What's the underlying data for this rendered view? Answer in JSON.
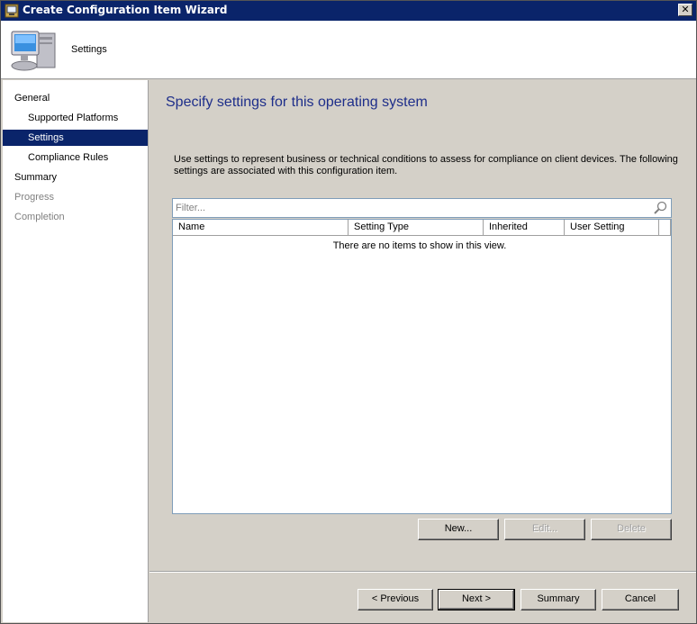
{
  "window": {
    "title": "Create Configuration Item Wizard",
    "close_glyph": "✕"
  },
  "header": {
    "title": "Settings",
    "icon": "computer-icon"
  },
  "nav": {
    "items": [
      {
        "label": "General",
        "state": "normal"
      },
      {
        "label": "Supported Platforms",
        "state": "normal"
      },
      {
        "label": "Settings",
        "state": "selected"
      },
      {
        "label": "Compliance Rules",
        "state": "normal"
      },
      {
        "label": "Summary",
        "state": "normal"
      },
      {
        "label": "Progress",
        "state": "disabled"
      },
      {
        "label": "Completion",
        "state": "disabled"
      }
    ]
  },
  "main": {
    "heading": "Specify settings for this operating system",
    "description": "Use settings to represent business or technical conditions to assess for compliance on client devices. The following settings are associated with this configuration item.",
    "filter": {
      "placeholder": "Filter...",
      "value": ""
    },
    "grid": {
      "columns": [
        "Name",
        "Setting Type",
        "Inherited",
        "User Setting"
      ],
      "empty_message": "There are no items to show in this view."
    },
    "buttons": {
      "new": "New...",
      "edit": "Edit...",
      "delete": "Delete"
    }
  },
  "footer": {
    "previous": "< Previous",
    "next": "Next >",
    "summary": "Summary",
    "cancel": "Cancel"
  },
  "colors": {
    "title_bar": "#0a246a",
    "heading": "#1e2e8a",
    "selected": "#0a246a"
  }
}
